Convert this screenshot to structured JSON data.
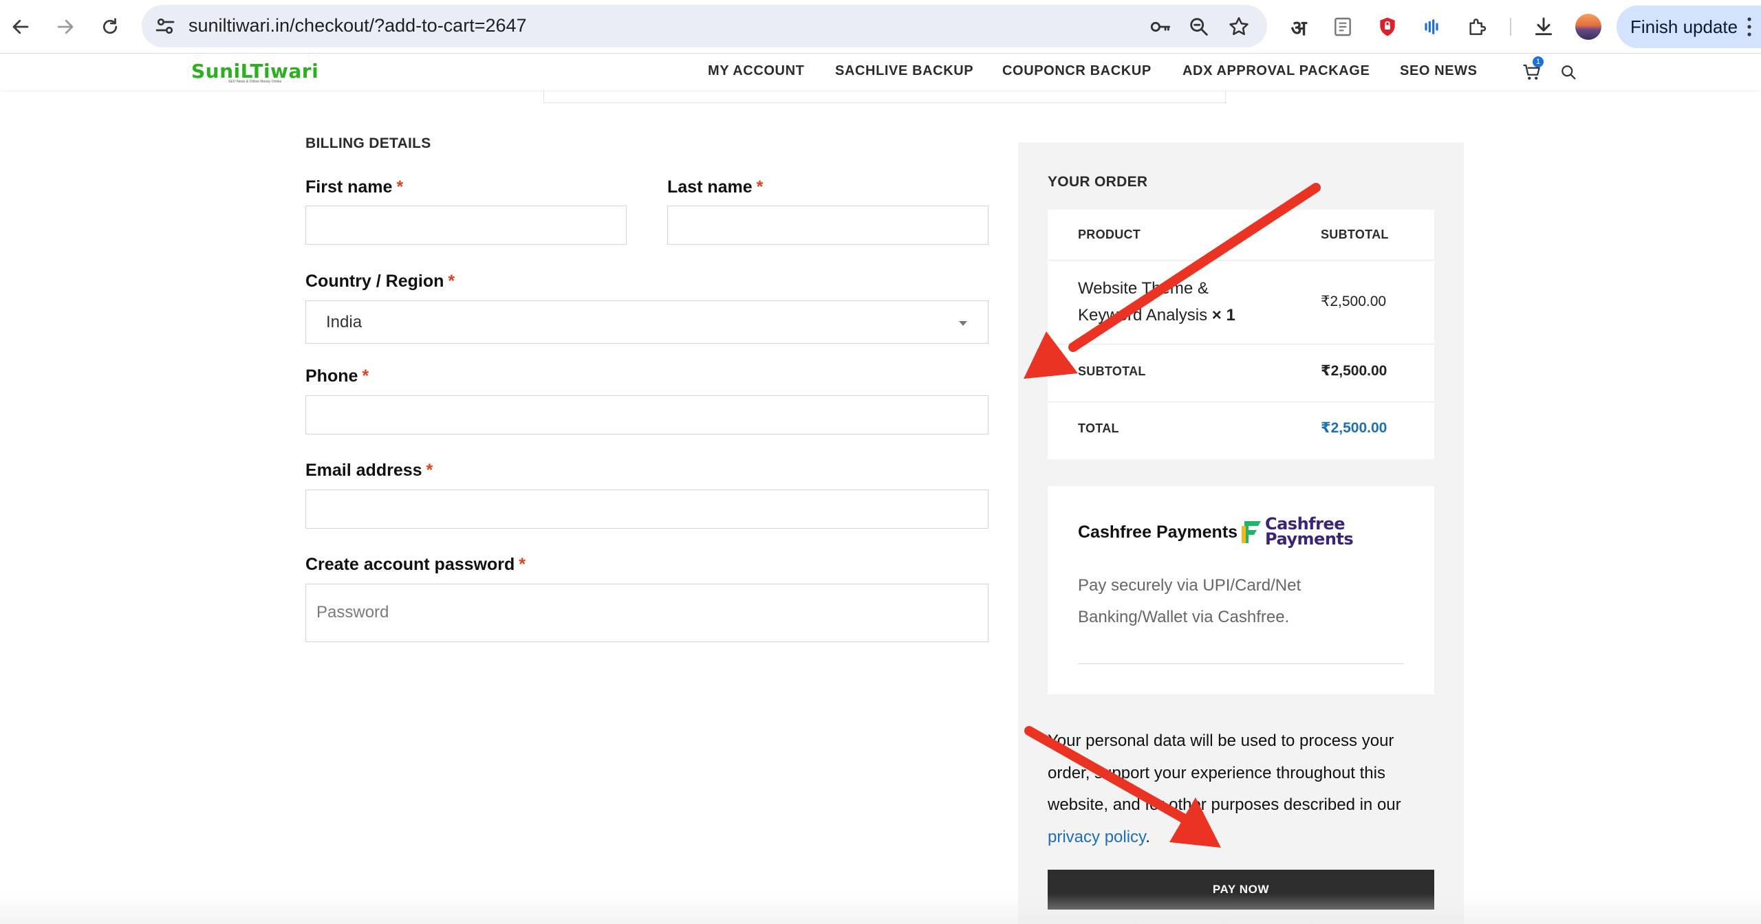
{
  "browser": {
    "url": "suniltiwari.in/checkout/?add-to-cart=2647",
    "translate_glyph": "अ",
    "finish_update_label": "Finish update"
  },
  "site": {
    "logo_text": "SuniLTiwari",
    "logo_tagline": "SEO News & Online Money Online",
    "menu": [
      "MY ACCOUNT",
      "SACHLIVE BACKUP",
      "COUPONCR BACKUP",
      "ADX APPROVAL PACKAGE",
      "SEO NEWS"
    ],
    "cart_count": "1"
  },
  "billing": {
    "section_title": "BILLING DETAILS",
    "required_mark": "*",
    "first_name_label": "First name",
    "last_name_label": "Last name",
    "country_label": "Country / Region",
    "country_value": "India",
    "phone_label": "Phone",
    "email_label": "Email address",
    "password_label": "Create account password",
    "password_placeholder": "Password"
  },
  "order": {
    "section_title": "YOUR ORDER",
    "col_product": "PRODUCT",
    "col_subtotal": "SUBTOTAL",
    "product_name": "Website Theme & Keyword Analysis",
    "product_qty": "× 1",
    "product_price": "₹2,500.00",
    "subtotal_label": "SUBTOTAL",
    "subtotal_value": "₹2,500.00",
    "total_label": "TOTAL",
    "total_value": "₹2,500.00"
  },
  "payment": {
    "method_title": "Cashfree Payments",
    "logo_line1": "Cashfree",
    "logo_line2": "Payments",
    "description": "Pay securely via UPI/Card/Net Banking/Wallet via Cashfree.",
    "privacy_text": "Your personal data will be used to process your order, support your experience throughout this website, and for other purposes described in our ",
    "privacy_link": "privacy policy",
    "privacy_end": ".",
    "pay_button": "PAY NOW"
  },
  "colors": {
    "logo_green": "#2bb01e",
    "required_red": "#e2401c",
    "link_blue": "#1e6fb5",
    "annotation_arrow": "#ea3323",
    "pay_button_bg": "#2d2d2d"
  }
}
